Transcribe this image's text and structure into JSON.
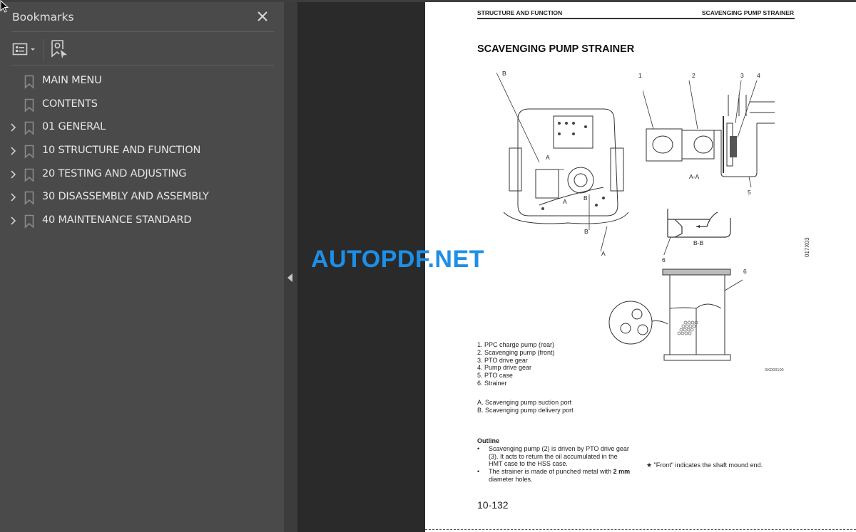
{
  "sidebar": {
    "title": "Bookmarks",
    "close_icon": "close-icon",
    "toolbar": {
      "options_icon": "list-options-icon",
      "find_icon": "find-current-bookmark-icon"
    },
    "items": [
      {
        "label": "MAIN MENU",
        "expandable": false
      },
      {
        "label": "CONTENTS",
        "expandable": false
      },
      {
        "label": "01 GENERAL",
        "expandable": true
      },
      {
        "label": "10 STRUCTURE AND FUNCTION",
        "expandable": true
      },
      {
        "label": "20 TESTING AND ADJUSTING",
        "expandable": true
      },
      {
        "label": "30 DISASSEMBLY AND ASSEMBLY",
        "expandable": true
      },
      {
        "label": "40 MAINTENANCE STANDARD",
        "expandable": true
      }
    ]
  },
  "watermark": "AUTOPDF.NET",
  "page": {
    "header_left": "STRUCTURE AND FUNCTION",
    "header_right": "SCAVENGING PUMP STRAINER",
    "title": "SCAVENGING PUMP STRAINER",
    "figure_labels": {
      "B_top": "B",
      "A_inner": "A",
      "B_inner1": "B",
      "A_inner2": "A",
      "B_inner2": "B",
      "A_bottom": "A",
      "n1": "1",
      "n2": "2",
      "n3": "3",
      "n4": "4",
      "n5": "5",
      "n6a": "6",
      "n6b": "6",
      "section_aa": "A-A",
      "section_bb": "B-B"
    },
    "figure_code": "SKD00100",
    "vertical_code": "017X03",
    "legend_numbered": [
      "1. PPC charge pump (rear)",
      "2. Scavenging pump (front)",
      "3. PTO drive gear",
      "4. Pump drive gear",
      "5. PTO case",
      "6. Strainer"
    ],
    "legend_lettered": [
      "A. Scavenging pump suction port",
      "B. Scavenging pump delivery port"
    ],
    "outline": {
      "title": "Outline",
      "bullets": [
        "Scavenging pump (2) is driven by PTO drive gear (3).  It acts to return the oil accumulated in the HMT case to the HSS case.",
        "The strainer is made of punched metal with"
      ],
      "bullet2_bold": "2 mm",
      "bullet2_rest": " diameter holes."
    },
    "note": "★  \"Front\" indicates the shaft mound end.",
    "page_number": "10-132"
  }
}
